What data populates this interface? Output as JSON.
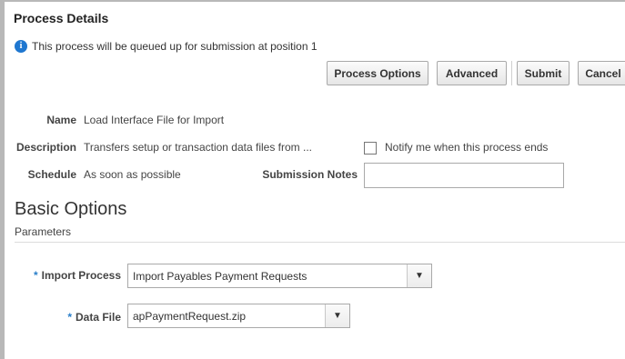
{
  "dialog": {
    "title": "Process Details",
    "info_message": "This process will be queued up for submission at position 1"
  },
  "buttons": {
    "process_options": "Process Options",
    "advanced": "Advanced",
    "submit": "Submit",
    "cancel": "Cancel"
  },
  "details": {
    "name_label": "Name",
    "name_value": "Load Interface File for Import",
    "description_label": "Description",
    "description_value": "Transfers setup or transaction data files from ...",
    "notify_label": "Notify me when this process ends",
    "notify_checked": false,
    "schedule_label": "Schedule",
    "schedule_value": "As soon as possible",
    "submission_notes_label": "Submission Notes",
    "submission_notes_value": ""
  },
  "basic_options": {
    "title": "Basic Options",
    "parameters_label": "Parameters",
    "required_marker": "*",
    "import_process_label": "Import Process",
    "import_process_value": "Import Payables Payment Requests",
    "data_file_label": "Data File",
    "data_file_value": "apPaymentRequest.zip"
  },
  "icons": {
    "info": "info-icon",
    "dropdown": "chevron-down-icon"
  },
  "colors": {
    "info_icon": "#1f77d0",
    "required_marker": "#2a7fc9"
  }
}
